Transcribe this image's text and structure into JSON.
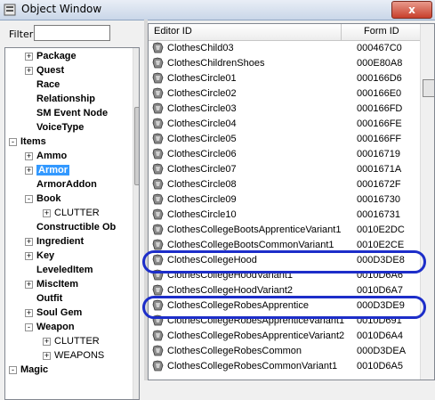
{
  "window": {
    "title": "Object Window",
    "close_glyph": "x"
  },
  "filter": {
    "label": "Filter",
    "value": ""
  },
  "tree": [
    {
      "label": "Package",
      "bold": true,
      "expander": "+",
      "depth": 1
    },
    {
      "label": "Quest",
      "bold": true,
      "expander": "+",
      "depth": 1
    },
    {
      "label": "Race",
      "bold": true,
      "expander": "",
      "depth": 1
    },
    {
      "label": "Relationship",
      "bold": true,
      "expander": "",
      "depth": 1
    },
    {
      "label": "SM Event Node",
      "bold": true,
      "expander": "",
      "depth": 1
    },
    {
      "label": "VoiceType",
      "bold": true,
      "expander": "",
      "depth": 1
    },
    {
      "label": "Items",
      "bold": true,
      "expander": "-",
      "depth": 0
    },
    {
      "label": "Ammo",
      "bold": true,
      "expander": "+",
      "depth": 1
    },
    {
      "label": "Armor",
      "bold": true,
      "expander": "+",
      "depth": 1,
      "selected": true
    },
    {
      "label": "ArmorAddon",
      "bold": true,
      "expander": "",
      "depth": 1
    },
    {
      "label": "Book",
      "bold": true,
      "expander": "-",
      "depth": 1
    },
    {
      "label": "CLUTTER",
      "bold": false,
      "expander": "+",
      "depth": 2
    },
    {
      "label": "Constructible Ob",
      "bold": true,
      "expander": "",
      "depth": 1
    },
    {
      "label": "Ingredient",
      "bold": true,
      "expander": "+",
      "depth": 1
    },
    {
      "label": "Key",
      "bold": true,
      "expander": "+",
      "depth": 1
    },
    {
      "label": "LeveledItem",
      "bold": true,
      "expander": "",
      "depth": 1
    },
    {
      "label": "MiscItem",
      "bold": true,
      "expander": "+",
      "depth": 1
    },
    {
      "label": "Outfit",
      "bold": true,
      "expander": "",
      "depth": 1
    },
    {
      "label": "Soul Gem",
      "bold": true,
      "expander": "+",
      "depth": 1
    },
    {
      "label": "Weapon",
      "bold": true,
      "expander": "-",
      "depth": 1
    },
    {
      "label": "CLUTTER",
      "bold": false,
      "expander": "+",
      "depth": 2
    },
    {
      "label": "WEAPONS",
      "bold": false,
      "expander": "+",
      "depth": 2
    },
    {
      "label": "Magic",
      "bold": true,
      "expander": "-",
      "depth": 0
    }
  ],
  "list": {
    "columns": [
      "Editor ID",
      "Form ID"
    ],
    "rows": [
      {
        "editor_id": "ClothesChild03",
        "form_id": "000467C0"
      },
      {
        "editor_id": "ClothesChildrenShoes",
        "form_id": "000E80A8"
      },
      {
        "editor_id": "ClothesCircle01",
        "form_id": "000166D6"
      },
      {
        "editor_id": "ClothesCircle02",
        "form_id": "000166E0"
      },
      {
        "editor_id": "ClothesCircle03",
        "form_id": "000166FD"
      },
      {
        "editor_id": "ClothesCircle04",
        "form_id": "000166FE"
      },
      {
        "editor_id": "ClothesCircle05",
        "form_id": "000166FF"
      },
      {
        "editor_id": "ClothesCircle06",
        "form_id": "00016719"
      },
      {
        "editor_id": "ClothesCircle07",
        "form_id": "0001671A"
      },
      {
        "editor_id": "ClothesCircle08",
        "form_id": "0001672F"
      },
      {
        "editor_id": "ClothesCircle09",
        "form_id": "00016730"
      },
      {
        "editor_id": "ClothesCircle10",
        "form_id": "00016731"
      },
      {
        "editor_id": "ClothesCollegeBootsApprenticeVariant1",
        "form_id": "0010E2DC"
      },
      {
        "editor_id": "ClothesCollegeBootsCommonVariant1",
        "form_id": "0010E2CE"
      },
      {
        "editor_id": "ClothesCollegeHood",
        "form_id": "000D3DE8"
      },
      {
        "editor_id": "ClothesCollegeHoodVariant1",
        "form_id": "0010D6A6"
      },
      {
        "editor_id": "ClothesCollegeHoodVariant2",
        "form_id": "0010D6A7"
      },
      {
        "editor_id": "ClothesCollegeRobesApprentice",
        "form_id": "000D3DE9"
      },
      {
        "editor_id": "ClothesCollegeRobesApprenticeVariant1",
        "form_id": "0010D691"
      },
      {
        "editor_id": "ClothesCollegeRobesApprenticeVariant2",
        "form_id": "0010D6A4"
      },
      {
        "editor_id": "ClothesCollegeRobesCommon",
        "form_id": "000D3DEA"
      },
      {
        "editor_id": "ClothesCollegeRobesCommonVariant1",
        "form_id": "0010D6A5"
      }
    ]
  },
  "colors": {
    "selection": "#3399ff",
    "callout": "#1d2ec9"
  }
}
